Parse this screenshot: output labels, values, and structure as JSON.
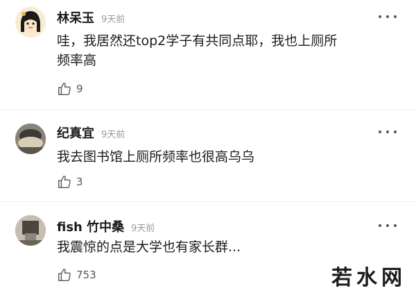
{
  "comments": [
    {
      "author": "林呆玉",
      "time": "9天前",
      "text": "哇，我居然还top2学子有共同点耶，我也上厕所\n频率高",
      "likes": "9"
    },
    {
      "author": "纪真宜",
      "time": "9天前",
      "text": "我去图书馆上厕所频率也很高乌乌",
      "likes": "3"
    },
    {
      "author": "fish 竹中桑",
      "time": "9天前",
      "text": "我震惊的点是大学也有家长群...",
      "likes": "753"
    }
  ],
  "watermark": {
    "text": "若水网"
  },
  "colors": {
    "text": "#1a1a1a",
    "meta": "#9a9a9a",
    "divider": "#eeeeee"
  }
}
